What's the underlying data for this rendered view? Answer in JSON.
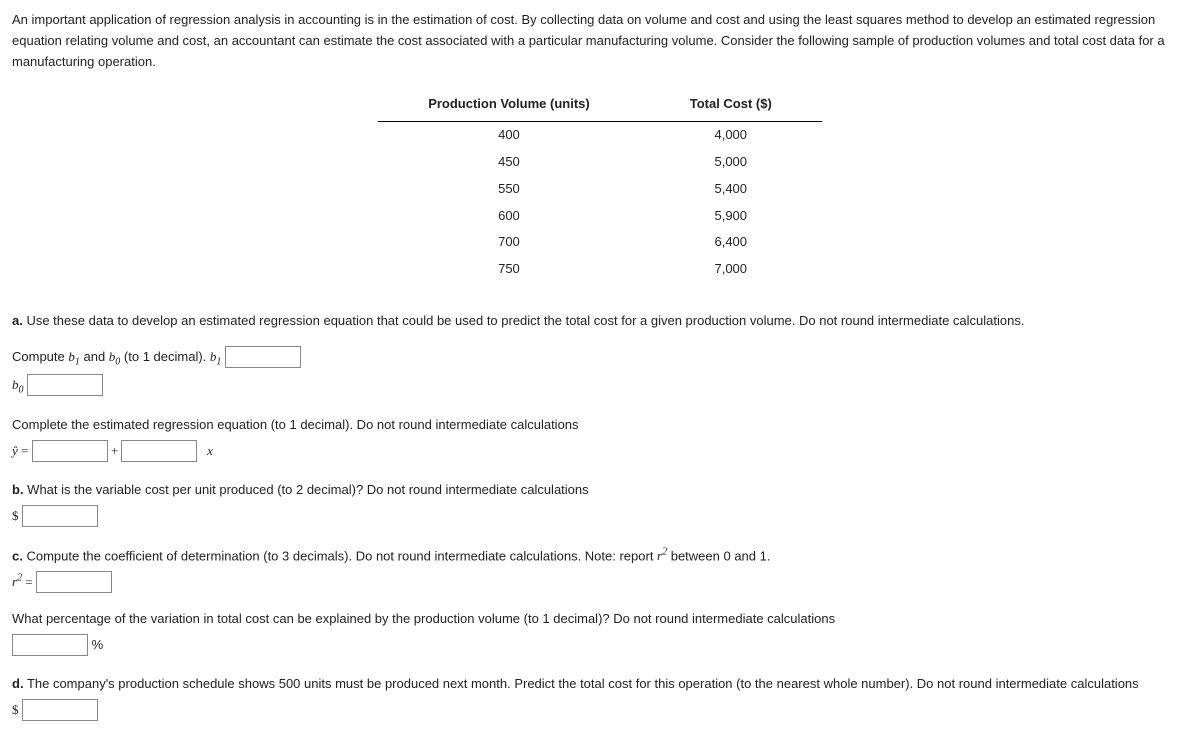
{
  "intro": "An important application of regression analysis in accounting is in the estimation of cost. By collecting data on volume and cost and using the least squares method to develop an estimated regression equation relating volume and cost, an accountant can estimate the cost associated with a particular manufacturing volume. Consider the following sample of production volumes and total cost data for a manufacturing operation.",
  "table": {
    "headers": [
      "Production Volume (units)",
      "Total Cost ($)"
    ],
    "rows": [
      [
        "400",
        "4,000"
      ],
      [
        "450",
        "5,000"
      ],
      [
        "550",
        "5,400"
      ],
      [
        "600",
        "5,900"
      ],
      [
        "700",
        "6,400"
      ],
      [
        "750",
        "7,000"
      ]
    ]
  },
  "a": {
    "prompt_label": "a.",
    "prompt_text": " Use these data to develop an estimated regression equation that could be used to predict the total cost for a given production volume. Do not round intermediate calculations.",
    "compute_pre": "Compute ",
    "compute_mid": " and ",
    "compute_post": " (to 1 decimal). ",
    "b1": "b",
    "sub1": "1",
    "b0": "b",
    "sub0": "0",
    "complete_text": "Complete the estimated regression equation (to 1 decimal). Do not round intermediate calculations",
    "yhat": "ŷ",
    "equals": " = ",
    "plus": " + ",
    "x": "x"
  },
  "b": {
    "label": "b.",
    "text": " What is the variable cost per unit produced (to 2 decimal)? Do not round intermediate calculations",
    "dollar": "$"
  },
  "c": {
    "label": "c.",
    "text": " Compute the coefficient of determination (to 3 decimals). Do not round intermediate calculations. Note: report ",
    "r2_sym": "r",
    "r2_sup": "2",
    "text2": " between 0 and 1.",
    "eq": " = ",
    "pct_text": "What percentage of the variation in total cost can be explained by the production volume (to 1 decimal)? Do not round intermediate calculations",
    "pct_sign": "%"
  },
  "d": {
    "label": "d.",
    "text": " The company's production schedule shows 500 units must be produced next month. Predict the total cost for this operation (to the nearest whole number). Do not round intermediate calculations",
    "dollar": "$"
  }
}
